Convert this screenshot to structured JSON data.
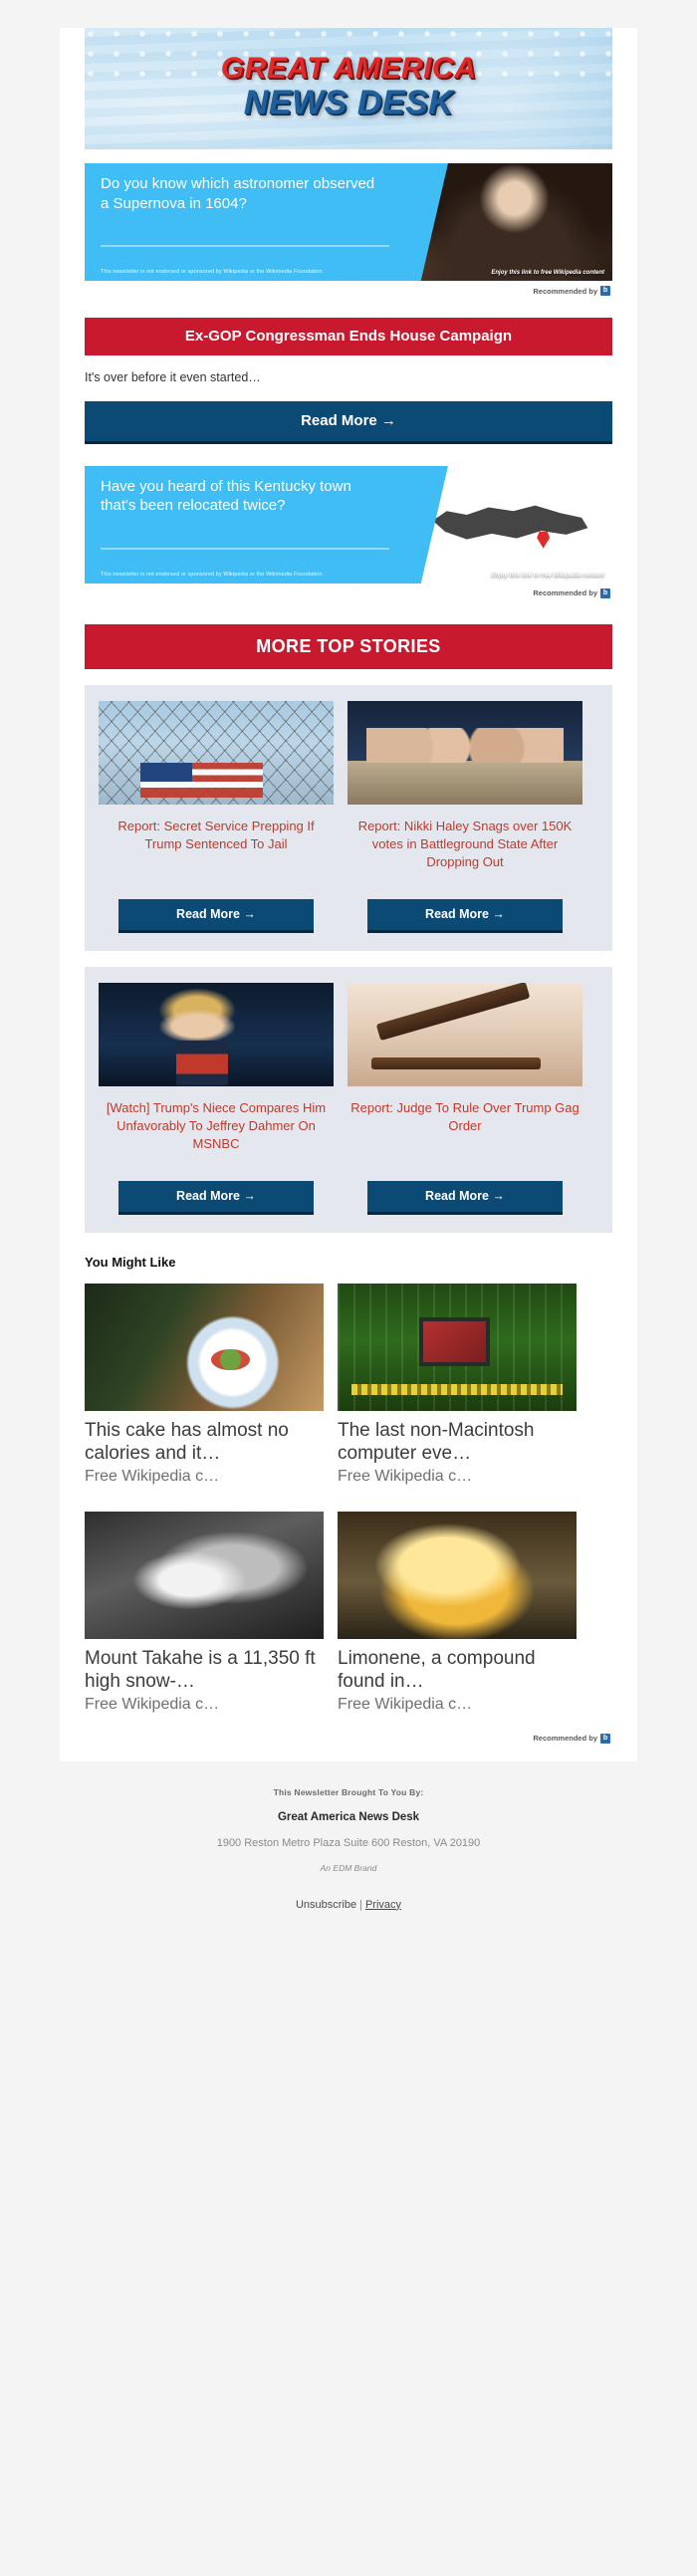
{
  "banner": {
    "line1": "GREAT AMERICA",
    "line2": "NEWS DESK"
  },
  "colors": {
    "red": "#c8192e",
    "navy": "#0b4a75",
    "cyan": "#3fbdf4",
    "headline_red": "#c0392b",
    "card_bg": "#e4e8ee",
    "page_bg": "#f4f4f4"
  },
  "ads": [
    {
      "title": "Do you know which astronomer observed a Supernova in 1604?",
      "disclaimer": "This newsletter is not endorsed or sponsored by Wikipedia or the Wikimedia Foundation.",
      "enjoy": "Enjoy this link to free Wikipedia content",
      "recommended_by": "Recommended by",
      "logo_letter": "b",
      "image_name": "kepler-portrait-photo"
    },
    {
      "title": "Have you heard of this Kentucky town that's been relocated twice?",
      "disclaimer": "This newsletter is not endorsed or sponsored by Wikipedia or the Wikimedia Foundation.",
      "enjoy": "Enjoy this link to free Wikipedia content",
      "recommended_by": "Recommended by",
      "logo_letter": "b",
      "image_name": "kentucky-map-photo"
    }
  ],
  "lead_story": {
    "headline": "Ex-GOP Congressman Ends House Campaign",
    "dek": "It's over before it even started…",
    "cta": "Read More  →"
  },
  "more_stories": {
    "section_title": "MORE TOP STORIES",
    "cta": "Read More  →",
    "items": [
      {
        "headline": "Report: Secret Service Prepping If Trump Sentenced To Jail",
        "image_name": "prison-fence-flag-photo"
      },
      {
        "headline": "Report: Nikki Haley Snags over 150K votes in Battleground State After Dropping Out",
        "image_name": "panel-hearing-photo"
      },
      {
        "headline": "[Watch] Trump's Niece Compares Him Unfavorably To Jeffrey Dahmer On MSNBC",
        "image_name": "trump-rally-photo"
      },
      {
        "headline": "Report: Judge To Rule Over Trump Gag Order",
        "image_name": "gavel-photo"
      }
    ]
  },
  "you_might_like": {
    "title": "You Might Like",
    "recommended_by": "Recommended by",
    "logo_letter": "b",
    "items": [
      {
        "headline": "This cake has almost no calories and it…",
        "subtitle": "Free Wikipedia c…",
        "image_name": "cake-plate-photo"
      },
      {
        "headline": "The last non-Macintosh computer eve…",
        "subtitle": "Free Wikipedia c…",
        "image_name": "circuit-board-photo"
      },
      {
        "headline": "Mount Takahe is a 11,350 ft high snow-…",
        "subtitle": "Free Wikipedia c…",
        "image_name": "mount-takahe-photo"
      },
      {
        "headline": "Limonene, a compound found in…",
        "subtitle": "Free Wikipedia c…",
        "image_name": "limonene-drop-photo"
      }
    ]
  },
  "footer": {
    "brought_by": "This Newsletter Brought To You By:",
    "brand": "Great America News Desk",
    "address": "1900 Reston Metro Plaza Suite 600 Reston, VA 20190",
    "edm": "An EDM Brand",
    "unsubscribe": "Unsubscribe",
    "separator": "|",
    "privacy": "Privacy"
  }
}
